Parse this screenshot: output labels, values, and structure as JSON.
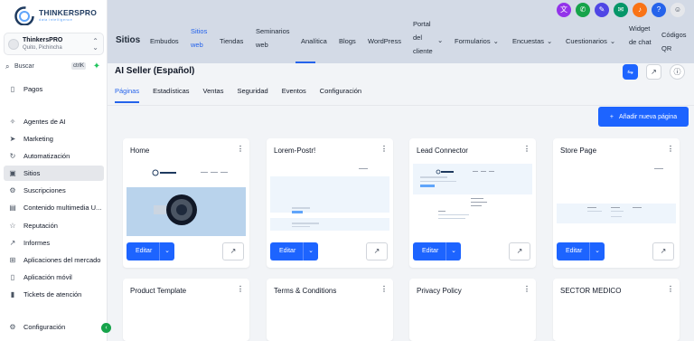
{
  "brand": {
    "name": "THINKERSPRO",
    "tagline": "data intelligence"
  },
  "account": {
    "name": "ThinkersPRO",
    "location": "Quito, Pichincha"
  },
  "search": {
    "placeholder": "Buscar",
    "shortcut": "ctrlK"
  },
  "sidebar": {
    "items": [
      {
        "label": "Pagos",
        "icon": "wallet-icon"
      },
      {
        "label": "Agentes de AI",
        "icon": "sparkle-icon"
      },
      {
        "label": "Marketing",
        "icon": "send-icon"
      },
      {
        "label": "Automatización",
        "icon": "refresh-icon"
      },
      {
        "label": "Sitios",
        "icon": "browser-icon"
      },
      {
        "label": "Suscripciones",
        "icon": "gear-icon"
      },
      {
        "label": "Contenido multimedia U...",
        "icon": "media-icon"
      },
      {
        "label": "Reputación",
        "icon": "star-icon"
      },
      {
        "label": "Informes",
        "icon": "chart-icon"
      },
      {
        "label": "Aplicaciones del mercado",
        "icon": "grid-icon"
      },
      {
        "label": "Aplicación móvil",
        "icon": "phone-icon"
      },
      {
        "label": "Tickets de atención",
        "icon": "trash-icon"
      },
      {
        "label": "Configuración",
        "icon": "settings-icon"
      }
    ]
  },
  "topbar": {
    "section": "Sitios",
    "menu": [
      {
        "label": "Embudos"
      },
      {
        "label": "Sitios web"
      },
      {
        "label": "Tiendas"
      },
      {
        "label": "Seminarios web"
      },
      {
        "label": "Analítica"
      },
      {
        "label": "Blogs"
      },
      {
        "label": "WordPress"
      },
      {
        "label": "Portal del cliente"
      },
      {
        "label": "Formularios"
      },
      {
        "label": "Encuestas"
      },
      {
        "label": "Cuestionarios"
      },
      {
        "label": "Widget de chat"
      },
      {
        "label": "Códigos QR"
      }
    ]
  },
  "page": {
    "title": "AI Seller (Español)",
    "tabs": [
      "Páginas",
      "Estadísticas",
      "Ventas",
      "Seguridad",
      "Eventos",
      "Configuración"
    ],
    "add_button": "Añadir nueva página",
    "edit_label": "Editar"
  },
  "cards": [
    {
      "title": "Home"
    },
    {
      "title": "Lorem-Postr!"
    },
    {
      "title": "Lead Connector"
    },
    {
      "title": "Store Page"
    },
    {
      "title": "Product Template"
    },
    {
      "title": "Terms & Conditions"
    },
    {
      "title": "Privacy Policy"
    },
    {
      "title": "SECTOR MEDICO"
    }
  ],
  "colors": {
    "primary": "#1d64ff",
    "topbar": "#d3dae6",
    "brand": "#1e3a5f",
    "accent_green": "#16a34a"
  }
}
